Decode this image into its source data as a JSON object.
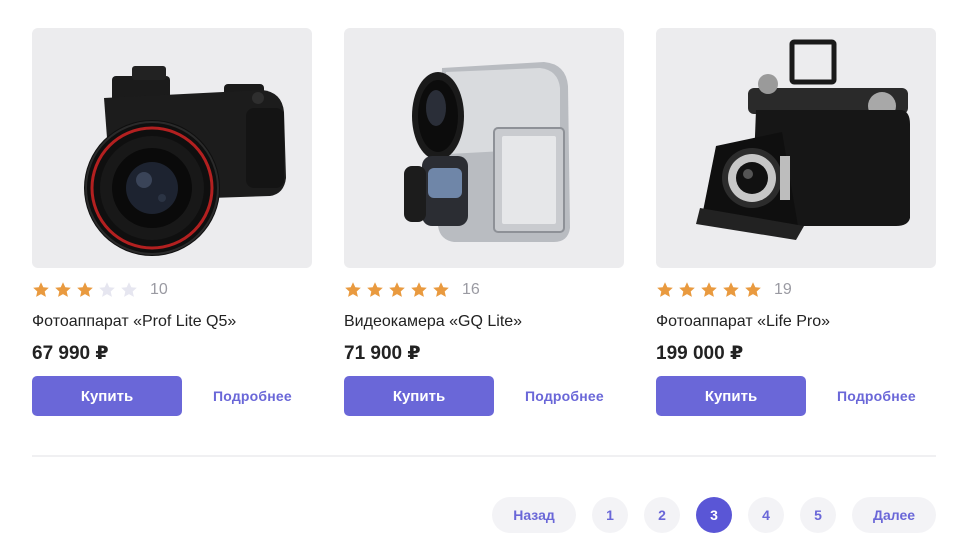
{
  "colors": {
    "accent": "#6a67d8",
    "star_filled": "#e99a3f",
    "star_empty": "#e6e6f0"
  },
  "products": [
    {
      "name": "Фотоаппарат «Prof Lite Q5»",
      "price": "67 990 ₽",
      "rating": 3,
      "reviews": "10",
      "buy_label": "Купить",
      "more_label": "Подробнее"
    },
    {
      "name": "Видеокамера «GQ Lite»",
      "price": "71 900 ₽",
      "rating": 5,
      "reviews": "16",
      "buy_label": "Купить",
      "more_label": "Подробнее"
    },
    {
      "name": "Фотоаппарат «Life Pro»",
      "price": "199 000 ₽",
      "rating": 5,
      "reviews": "19",
      "buy_label": "Купить",
      "more_label": "Подробнее"
    }
  ],
  "pagination": {
    "prev_label": "Назад",
    "next_label": "Далее",
    "pages": [
      "1",
      "2",
      "3",
      "4",
      "5"
    ],
    "current": "3"
  }
}
